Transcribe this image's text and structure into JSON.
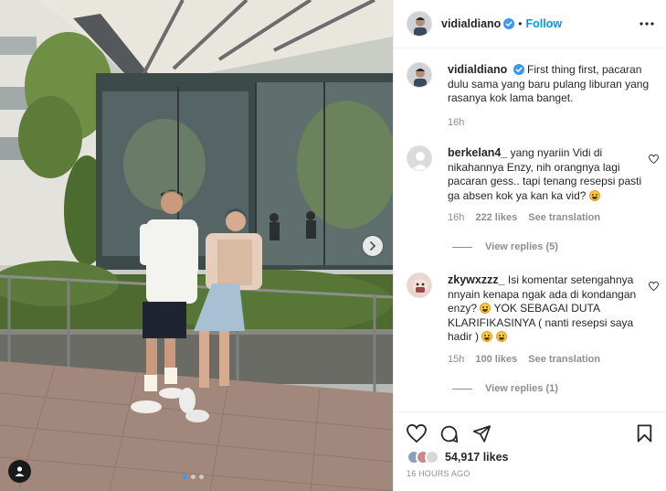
{
  "post": {
    "username": "vidialdiano",
    "follow_label": "Follow",
    "separator": "•",
    "image_alt": "",
    "carousel": {
      "total": 3,
      "active": 1
    }
  },
  "caption": {
    "username": "vidialdiano",
    "text": "First thing first, pacaran dulu sama yang baru pulang liburan yang rasanya kok lama banget.",
    "time": "16h"
  },
  "comments": [
    {
      "username": "berkelan4_",
      "text": "yang nyariin Vidi di nikahannya Enzy, nih orangnya lagi pacaran gess.. tapi tenang resepsi pasti ga absen kok ya kan ka vid?",
      "time": "16h",
      "likes": "222 likes",
      "translate": "See translation",
      "replies": "View replies (5)"
    },
    {
      "username": "zkywxzzz_",
      "text_1": "Isi komentar setengahnya nnyain kenapa ngak ada di kondangan enzy?",
      "text_2": " YOK SEBAGAI DUTA KLARIFIKASINYA ( nanti resepsi saya hadir ) ",
      "time": "15h",
      "likes": "100 likes",
      "translate": "See translation",
      "replies": "View replies (1)"
    }
  ],
  "footer": {
    "likes": "54,917 likes",
    "time_ago": "16 HOURS AGO"
  },
  "icons": {
    "verified": "verified-badge-icon",
    "more": "more-options-icon",
    "heart": "heart-icon",
    "comment": "comment-icon",
    "share": "share-icon",
    "save": "bookmark-icon",
    "next": "chevron-right-icon",
    "tag": "user-tag-icon"
  },
  "colors": {
    "accent": "#0095f6",
    "verified": "#3897f0",
    "muted": "#8e8e8e",
    "text": "#262626"
  }
}
